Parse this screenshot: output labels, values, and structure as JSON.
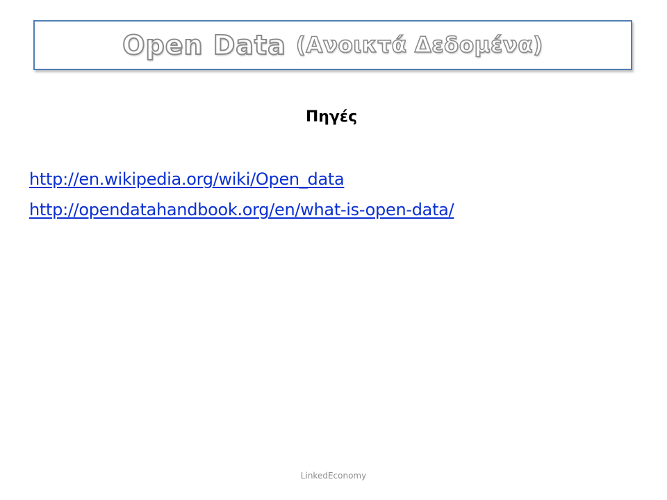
{
  "slide": {
    "title_main": "Open Data",
    "title_sub": "(Ανοικτά Δεδομένα)",
    "heading": "Πηγές",
    "links": [
      "http://en.wikipedia.org/wiki/Open_data",
      "http://opendatahandbook.org/en/what-is-open-data/"
    ],
    "footer": "LinkedEconomy"
  },
  "colors": {
    "title_border": "#4f7db5",
    "link": "#0b30d1",
    "footer": "#8c8c8c"
  }
}
